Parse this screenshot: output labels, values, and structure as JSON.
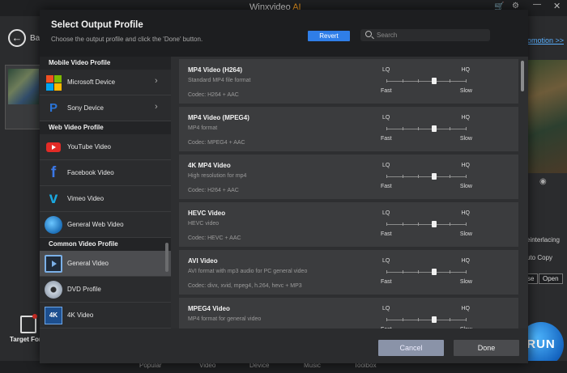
{
  "app": {
    "title": "Winxvideo",
    "title_suffix": "AI",
    "back_label": "Ba",
    "promo_link": "omotion >>",
    "deinterlacing": "einterlacing",
    "auto_copy": "uto Copy",
    "browse_btn": "se",
    "open_btn": "Open",
    "target_format": "Target For",
    "run_label": "RUN",
    "bottom_tabs": [
      "Popular",
      "Video",
      "Device",
      "Music",
      "Toolbox"
    ]
  },
  "dialog": {
    "title": "Select Output Profile",
    "subtitle": "Choose the output profile and click the 'Done' button.",
    "revert_label": "Revert",
    "search_placeholder": "Search",
    "cancel_label": "Cancel",
    "done_label": "Done"
  },
  "sidebar": {
    "categories": [
      {
        "header": "Mobile Video Profile",
        "items": [
          {
            "label": "Microsoft Device",
            "icon": "microsoft-icon",
            "chevron": true
          },
          {
            "label": "Sony Device",
            "icon": "playstation-icon",
            "chevron": true
          }
        ]
      },
      {
        "header": "Web Video Profile",
        "items": [
          {
            "label": "YouTube Video",
            "icon": "youtube-icon"
          },
          {
            "label": "Facebook Video",
            "icon": "facebook-icon"
          },
          {
            "label": "Vimeo Video",
            "icon": "vimeo-icon"
          },
          {
            "label": "General Web Video",
            "icon": "globe-icon"
          }
        ]
      },
      {
        "header": "Common Video Profile",
        "items": [
          {
            "label": "General Video",
            "icon": "video-icon",
            "active": true
          },
          {
            "label": "DVD Profile",
            "icon": "dvd-icon"
          },
          {
            "label": "4K Video",
            "icon": "4k-icon",
            "icon_text": "4K"
          }
        ]
      }
    ]
  },
  "quality": {
    "lq": "LQ",
    "hq": "HQ",
    "fast": "Fast",
    "slow": "Slow",
    "level": 0.6
  },
  "profiles": [
    {
      "name": "MP4 Video (H264)",
      "desc": "Standard MP4 file format",
      "codec": "Codec: H264 + AAC"
    },
    {
      "name": "MP4 Video (MPEG4)",
      "desc": "MP4 format",
      "codec": "Codec: MPEG4 + AAC"
    },
    {
      "name": "4K MP4 Video",
      "desc": "High resolution for mp4",
      "codec": "Codec: H264 + AAC"
    },
    {
      "name": "HEVC Video",
      "desc": "HEVC video",
      "codec": "Codec: HEVC + AAC"
    },
    {
      "name": "AVI Video",
      "desc": "AVI format with mp3 audio for PC general video",
      "codec": "Codec: divx, xvid, mpeg4, h.264, hevc + MP3"
    },
    {
      "name": "MPEG4 Video",
      "desc": "MP4 format for general video",
      "codec": ""
    }
  ],
  "colors": {
    "accent": "#2f7ee8",
    "logo_orange": "#f29a1e",
    "active_item": "#4c4d50"
  }
}
